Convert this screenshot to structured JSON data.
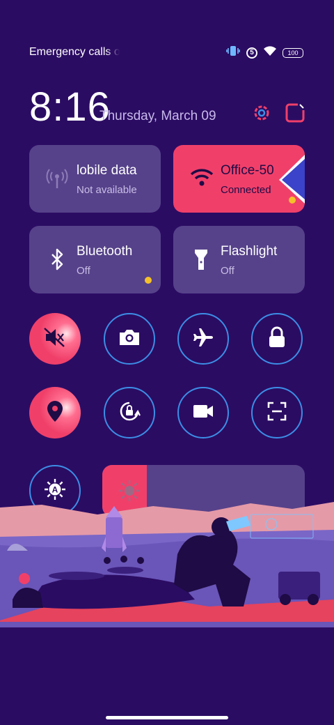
{
  "status_bar": {
    "carrier_text": "Emergency calls o",
    "sim_label": "5",
    "battery_level": "100"
  },
  "header": {
    "time": "8:16",
    "date": "Thursday, March 09"
  },
  "tiles": [
    {
      "name": "Mobile data",
      "shown_name": "lobile data",
      "status": "Not available",
      "icon": "signal-tower-icon",
      "active": false
    },
    {
      "name": "Wi-Fi",
      "shown_name": "Office-50",
      "status": "Connected",
      "icon": "wifi-icon",
      "active": true
    },
    {
      "name": "Bluetooth",
      "shown_name": "Bluetooth",
      "status": "Off",
      "icon": "bluetooth-icon",
      "active": false
    },
    {
      "name": "Flashlight",
      "shown_name": "Flashlight",
      "status": "Off",
      "icon": "flashlight-icon",
      "active": false
    }
  ],
  "toggles": [
    {
      "name": "mute",
      "icon": "mute-icon",
      "active": true
    },
    {
      "name": "screenshot",
      "icon": "camera-icon",
      "active": false
    },
    {
      "name": "airplane-mode",
      "icon": "airplane-icon",
      "active": false
    },
    {
      "name": "lock-screen",
      "icon": "lock-icon",
      "active": false
    },
    {
      "name": "location",
      "icon": "location-pin-icon",
      "active": true
    },
    {
      "name": "auto-rotate",
      "icon": "rotation-lock-icon",
      "active": false
    },
    {
      "name": "screen-record",
      "icon": "video-camera-icon",
      "active": false
    },
    {
      "name": "scanner",
      "icon": "scan-icon",
      "active": false
    }
  ],
  "brightness": {
    "auto_icon": "auto-brightness-icon",
    "level_fraction": 0.22
  },
  "colors": {
    "background": "#2b0c63",
    "accent": "#f0406a",
    "tile": "#56428a",
    "ring": "#3c8ee6",
    "dot": "#f5c12a"
  }
}
